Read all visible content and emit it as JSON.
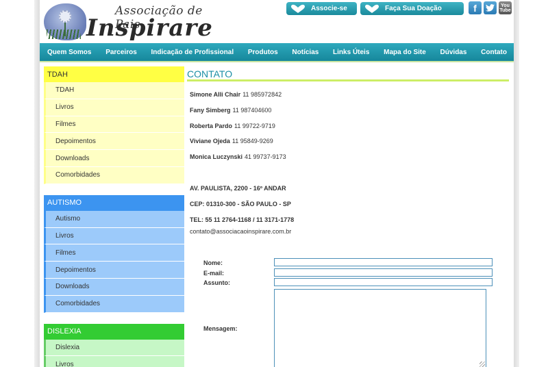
{
  "header": {
    "logo_line1": "Associação de Pais",
    "logo_line2": "Inspirare",
    "associe_label": "Associe-se",
    "doacao_label": "Faça Sua Doação",
    "social": [
      "facebook-icon",
      "twitter-icon",
      "youtube-icon"
    ],
    "youtube_text_top": "You",
    "youtube_text_bottom": "Tube"
  },
  "nav": {
    "items": [
      "Quem Somos",
      "Parceiros",
      "Indicação de Profissional",
      "Produtos",
      "Notícias",
      "Links Úteis",
      "Mapa do Site",
      "Dúvidas",
      "Contato"
    ]
  },
  "sidebar": {
    "tdah": {
      "title": "TDAH",
      "items": [
        "TDAH",
        "Livros",
        "Filmes",
        "Depoimentos",
        "Downloads",
        "Comorbidades"
      ]
    },
    "autismo": {
      "title": "AUTISMO",
      "items": [
        "Autismo",
        "Livros",
        "Filmes",
        "Depoimentos",
        "Downloads",
        "Comorbidades"
      ]
    },
    "dislexia": {
      "title": "DISLEXIA",
      "items": [
        "Dislexia",
        "Livros"
      ]
    }
  },
  "main": {
    "title": "CONTATO",
    "contacts": [
      {
        "name": "Simone Alli Chair",
        "phone": "11 985972842"
      },
      {
        "name": "Fany Simberg",
        "phone": "11 987404600"
      },
      {
        "name": "Roberta Pardo",
        "phone": "11 99722-9719"
      },
      {
        "name": "Viviane Ojeda",
        "phone": "11  95849-9269"
      },
      {
        "name": "Monica Luczynski",
        "phone": "41 99737-9173"
      }
    ],
    "address_line": "AV.  PAULISTA, 2200 - 16º ANDAR",
    "cep_line": "CEP: 01310-300 - SÃO PAULO -  SP",
    "tel_line": "TEL: 55 11 2764-1168 / 11 3171-1778",
    "email": "contato@associacaoinspirare.com.br"
  },
  "form": {
    "nome_label": "Nome:",
    "email_label": "E-mail:",
    "assunto_label": "Assunto:",
    "mensagem_label": "Mensagem:",
    "nome_value": "",
    "email_value": "",
    "assunto_value": "",
    "mensagem_value": ""
  },
  "colors": {
    "nav": "#1f97ab",
    "tdah": "#ffff44",
    "autismo": "#3c94f0",
    "dislexia": "#33cc33",
    "title": "#1a8ea4"
  }
}
